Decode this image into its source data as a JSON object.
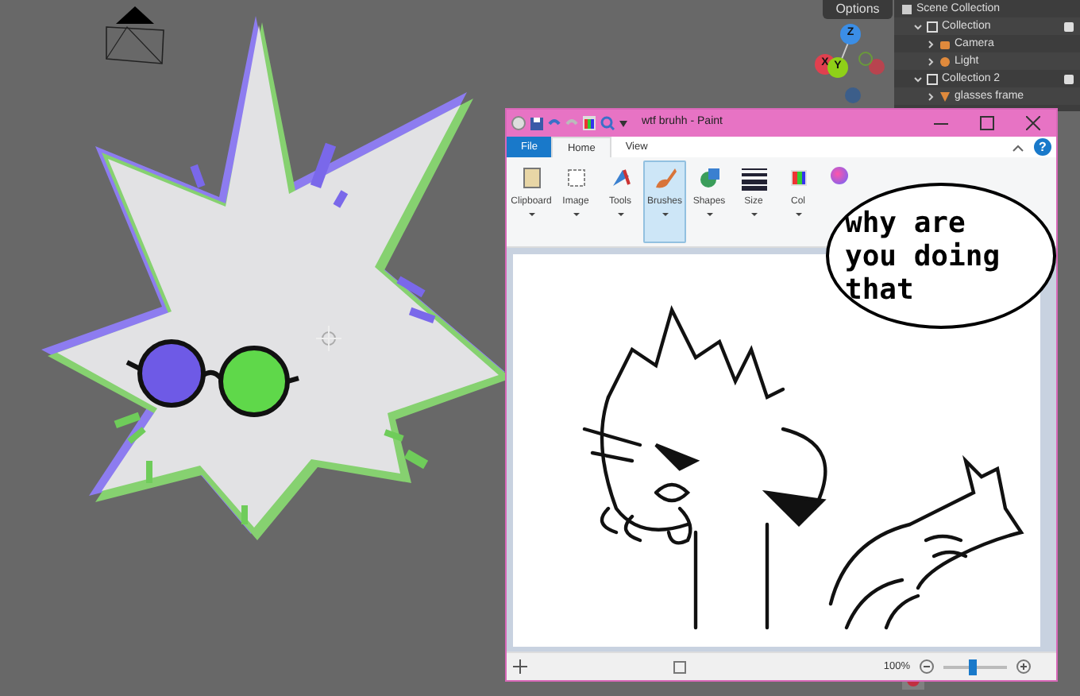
{
  "viewport": {
    "options_button": "Options",
    "gizmo_axes": [
      {
        "label": "Z",
        "color": "#3b8ee6"
      },
      {
        "label": "X",
        "color": "#e0404f"
      },
      {
        "label": "Y",
        "color": "#8fd018"
      }
    ]
  },
  "outliner": {
    "items": [
      {
        "label": "Scene Collection",
        "kind": "scene",
        "children": [
          {
            "label": "Collection",
            "kind": "collection",
            "expanded": true,
            "checked": true,
            "children": [
              {
                "label": "Camera",
                "kind": "camera",
                "expanded": false
              },
              {
                "label": "Light",
                "kind": "light",
                "expanded": false
              }
            ]
          },
          {
            "label": "Collection 2",
            "kind": "collection",
            "expanded": true,
            "checked": true,
            "children": [
              {
                "label": "glasses frame",
                "kind": "mesh",
                "expanded": false
              }
            ]
          }
        ]
      }
    ]
  },
  "paint": {
    "title": "wtf bruhh - Paint",
    "help_label": "?",
    "tabs": [
      {
        "label": "File",
        "selected": false
      },
      {
        "label": "Home",
        "selected": true
      },
      {
        "label": "View",
        "selected": false
      }
    ],
    "ribbon": [
      {
        "label": "Clipboard",
        "kind": "clipboard",
        "selected": false
      },
      {
        "label": "Image",
        "kind": "image",
        "selected": false
      },
      {
        "label": "Tools",
        "kind": "tools",
        "selected": false
      },
      {
        "label": "Brushes",
        "kind": "brushes",
        "selected": true
      },
      {
        "label": "Shapes",
        "kind": "shapes",
        "selected": false
      },
      {
        "label": "Size",
        "kind": "size",
        "selected": false
      },
      {
        "label": "Col",
        "kind": "colors",
        "selected": false
      }
    ],
    "speech_bubble": {
      "lines": [
        "why are",
        "you doing",
        "that"
      ]
    },
    "status_bar": {
      "zoom": "100%",
      "zoom_slider": {
        "level": 0.45
      }
    }
  }
}
